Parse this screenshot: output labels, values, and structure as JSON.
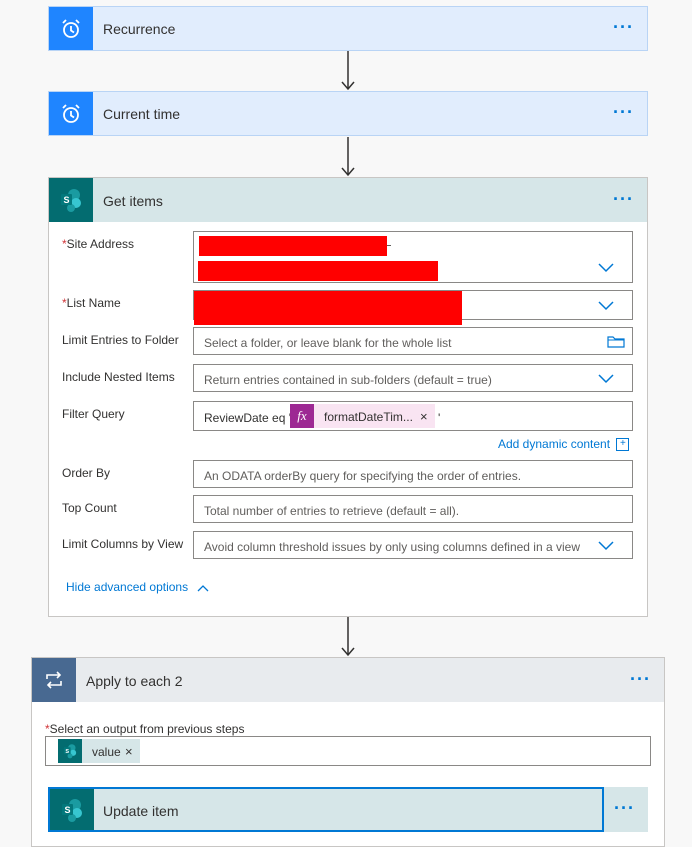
{
  "steps": {
    "recurrence": {
      "title": "Recurrence",
      "menu": "···"
    },
    "current_time": {
      "title": "Current time",
      "menu": "···"
    },
    "get_items": {
      "title": "Get items",
      "menu": "···",
      "fields": {
        "site_address": {
          "required": "*",
          "label": "Site Address"
        },
        "list_name": {
          "required": "*",
          "label": "List Name"
        },
        "limit_folder": {
          "label": "Limit Entries to Folder",
          "placeholder": "Select a folder, or leave blank for the whole list"
        },
        "nested_items": {
          "label": "Include Nested Items",
          "value": "Return entries contained in sub-folders (default = true)"
        },
        "filter_query": {
          "label": "Filter Query",
          "text_before": "ReviewDate eq '",
          "token_label": "formatDateTim...",
          "token_remove": "×",
          "text_after": "'"
        },
        "add_dynamic": "Add dynamic content",
        "order_by": {
          "label": "Order By",
          "placeholder": "An ODATA orderBy query for specifying the order of entries."
        },
        "top_count": {
          "label": "Top Count",
          "placeholder": "Total number of entries to retrieve (default = all)."
        },
        "limit_columns": {
          "label": "Limit Columns by View",
          "value": "Avoid column threshold issues by only using columns defined in a view"
        }
      },
      "hide_advanced": "Hide advanced options"
    },
    "apply_each": {
      "title": "Apply to each 2",
      "menu": "···",
      "select_label_required": "*",
      "select_label": "Select an output from previous steps",
      "token_label": "value",
      "token_remove": "×"
    },
    "update_item": {
      "title": "Update item",
      "menu": "···"
    }
  },
  "colors": {
    "schedule_header": "#e1edfd",
    "schedule_icon": "#1f85ff",
    "sharepoint_header": "#d6e6e8",
    "sharepoint_icon": "#036c70",
    "loop_header": "#e8ebee",
    "loop_icon": "#486991",
    "accent": "#0078d4",
    "expression_token": "#f9e4f2",
    "expression_icon": "#9d2893",
    "redaction": "#ff0000"
  },
  "icons": {
    "schedule": "alarm-clock-icon",
    "sharepoint": "sharepoint-icon",
    "loop": "loop-arrows-icon",
    "folder": "folder-icon",
    "chevron": "chevron-down-icon",
    "fx": "fx-icon"
  }
}
